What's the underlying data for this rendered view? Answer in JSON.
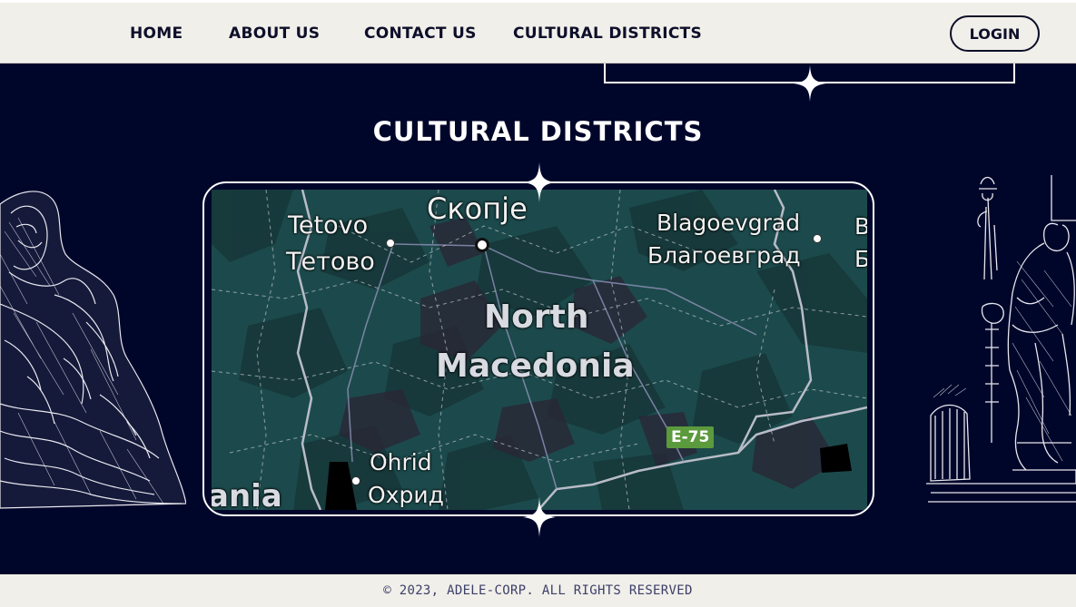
{
  "nav": {
    "items": [
      {
        "label": "HOME"
      },
      {
        "label": "ABOUT US"
      },
      {
        "label": "CONTACT US"
      },
      {
        "label": "CULTURAL DISTRICTS"
      }
    ],
    "login_label": "LOGIN"
  },
  "section": {
    "title": "CULTURAL DISTRICTS"
  },
  "map": {
    "labels": {
      "skopje": "Скопје",
      "tetovo_latin": "Tetovo",
      "tetovo_cyrillic": "Тетово",
      "blagoevgrad_latin": "Blagoevgrad",
      "blagoevgrad_cyrillic": "Благоевград",
      "country_line1": "North",
      "country_line2": "Macedonia",
      "ohrid_latin": "Ohrid",
      "ohrid_cyrillic": "Охрид",
      "albania_partial": "ania",
      "edge_latin": "B",
      "edge_cyrillic": "Б"
    },
    "road_badge": "E-75"
  },
  "footer": {
    "copyright": "© 2023, ADELE-CORP. ALL RIGHTS RESERVED"
  },
  "colors": {
    "page_background": "#00062a",
    "nav_background": "#f1efe9",
    "map_terrain": "#1c4a4c",
    "road_badge": "#5b9a3d"
  },
  "icons": {
    "sparkle": "four-point-star",
    "statue_left": "zeus-engraving",
    "statue_right": "seated-goddess-engraving"
  }
}
